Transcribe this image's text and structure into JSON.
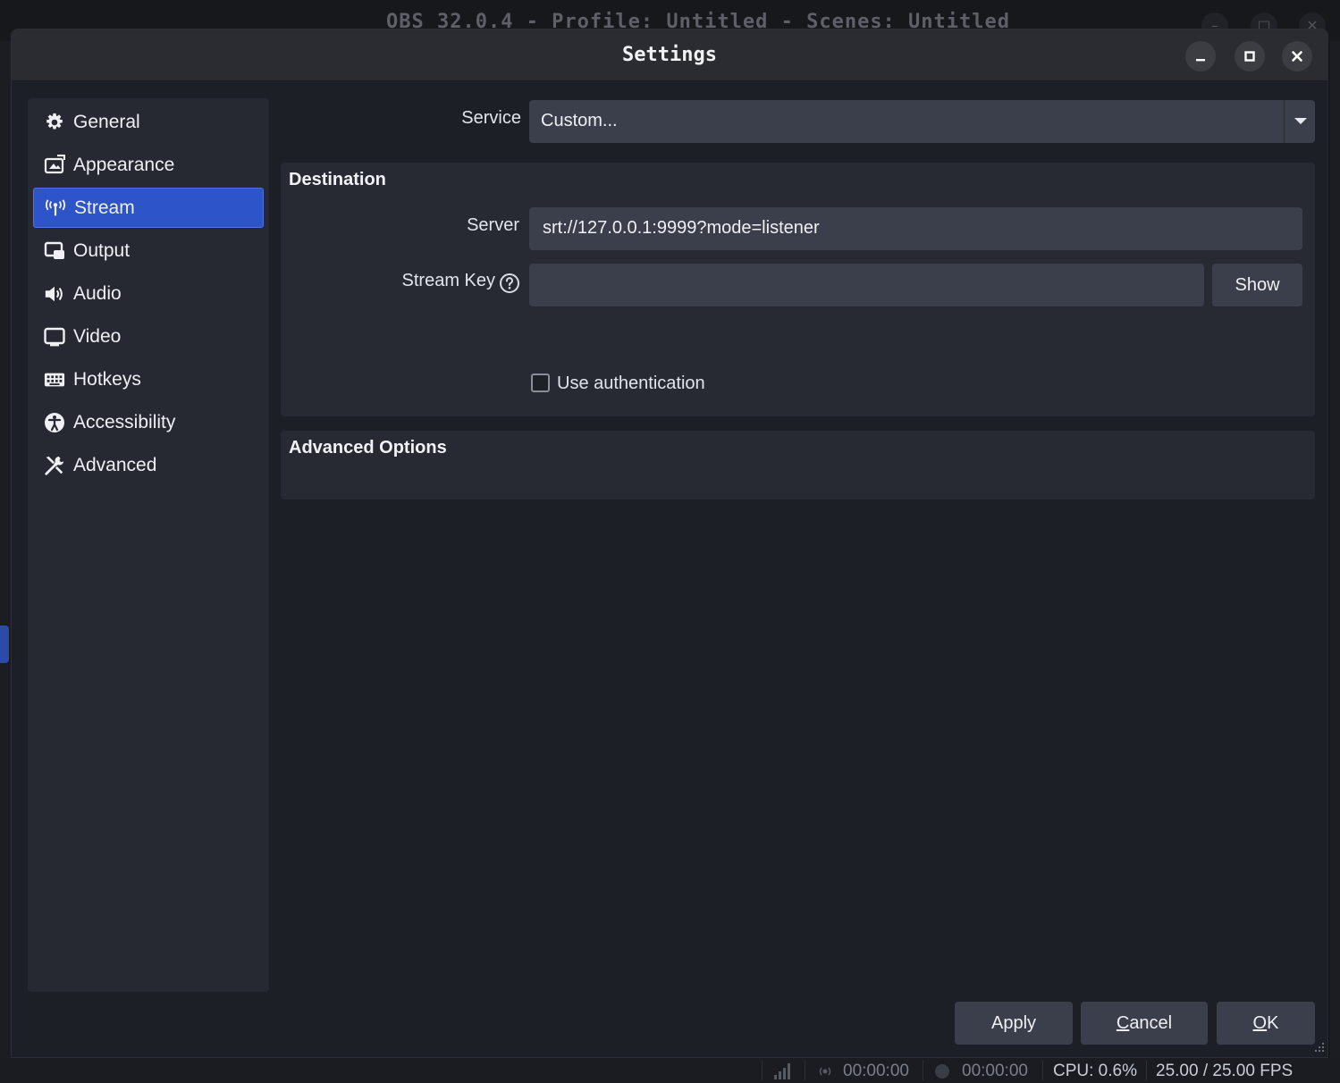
{
  "background_window": {
    "title": "OBS 32.0.4 - Profile: Untitled - Scenes: Untitled"
  },
  "dialog": {
    "title": "Settings",
    "window_buttons": [
      "minimize-icon",
      "maximize-icon",
      "close-icon"
    ]
  },
  "sidebar": {
    "items": [
      {
        "label": "General",
        "icon": "gear-icon",
        "active": false
      },
      {
        "label": "Appearance",
        "icon": "appearance-icon",
        "active": false
      },
      {
        "label": "Stream",
        "icon": "antenna-icon",
        "active": true
      },
      {
        "label": "Output",
        "icon": "output-icon",
        "active": false
      },
      {
        "label": "Audio",
        "icon": "speaker-icon",
        "active": false
      },
      {
        "label": "Video",
        "icon": "monitor-icon",
        "active": false
      },
      {
        "label": "Hotkeys",
        "icon": "keyboard-icon",
        "active": false
      },
      {
        "label": "Accessibility",
        "icon": "accessibility-icon",
        "active": false
      },
      {
        "label": "Advanced",
        "icon": "tools-icon",
        "active": false
      }
    ]
  },
  "stream": {
    "service_label": "Service",
    "service_value": "Custom...",
    "destination": {
      "title": "Destination",
      "server_label": "Server",
      "server_value": "srt://127.0.0.1:9999?mode=listener",
      "stream_key_label": "Stream Key",
      "stream_key_value": "",
      "show_button": "Show",
      "use_auth_label": "Use authentication",
      "use_auth_checked": false
    },
    "advanced_options": {
      "title": "Advanced Options"
    }
  },
  "footer": {
    "apply": "Apply",
    "cancel_rest": "ancel",
    "cancel_mnemonic": "C",
    "ok_mnemonic": "O",
    "ok_rest": "K"
  },
  "statusbar": {
    "stream_time": "00:00:00",
    "record_time": "00:00:00",
    "cpu": "CPU: 0.6%",
    "fps": "25.00 / 25.00 FPS"
  },
  "colors": {
    "accent": "#2d54c8",
    "dialog_bg": "#1d1f26",
    "panel_bg": "#272a33",
    "field_bg": "#3b3e4b"
  }
}
